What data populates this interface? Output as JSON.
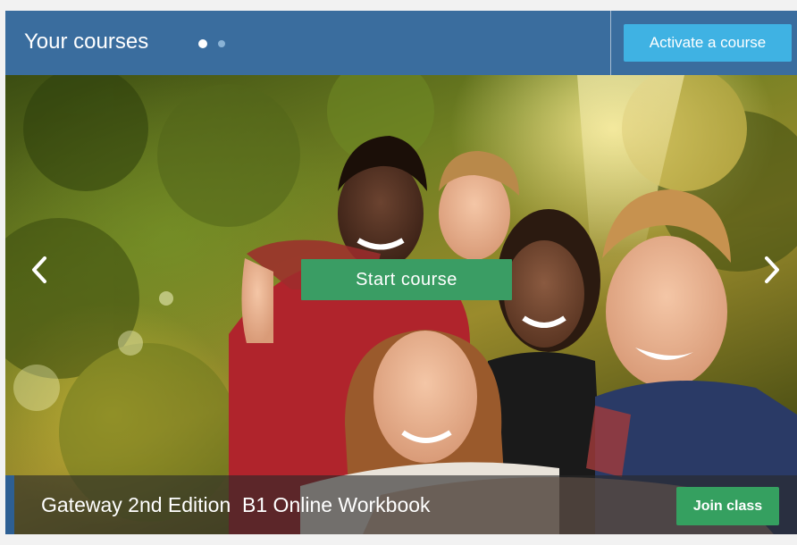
{
  "header": {
    "title": "Your courses",
    "carousel_dots": [
      {
        "state": "active"
      },
      {
        "state": "inactive"
      }
    ],
    "activate_button_label": "Activate a course"
  },
  "hero": {
    "image_icon": "students-selfie-photo",
    "prev_icon": "chevron-left-icon",
    "next_icon": "chevron-right-icon",
    "start_button_label": "Start course"
  },
  "footer": {
    "course_title": "Gateway 2nd Edition  B1 Online Workbook",
    "join_button_label": "Join class"
  },
  "colors": {
    "header_bg": "#3a6d9e",
    "activate_button": "#3fb2e3",
    "start_button": "#3a9d64",
    "join_button": "#35a060",
    "footer_accent": "#2d5f93"
  }
}
